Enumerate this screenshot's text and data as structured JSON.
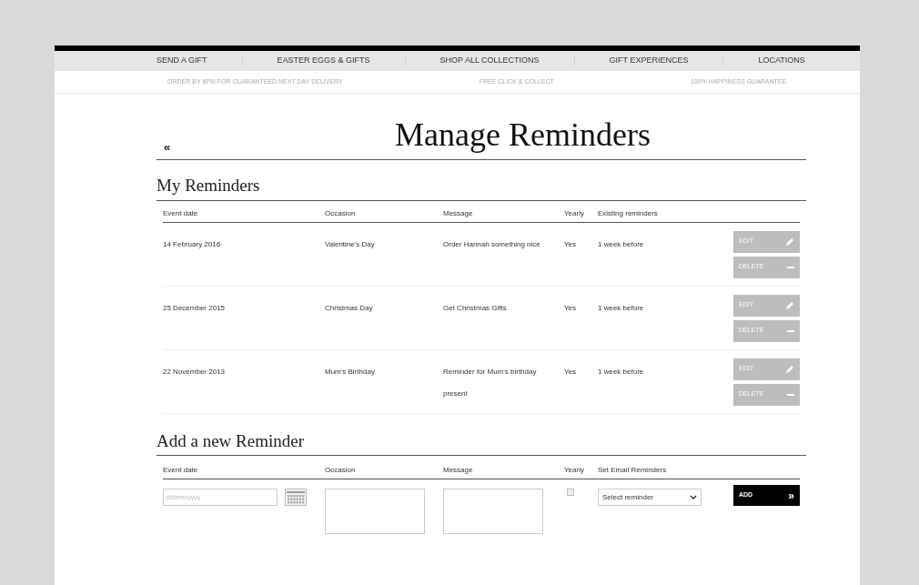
{
  "nav": {
    "items": [
      "SEND A GIFT",
      "EASTER EGGS & GIFTS",
      "SHOP ALL COLLECTIONS",
      "GIFT EXPERIENCES",
      "LOCATIONS"
    ],
    "promos": [
      "ORDER BY 6PM FOR GUARANTEED NEXT DAY DELIVERY",
      "FREE CLICK & COLLECT",
      "100% HAPPINESS GUARANTEE"
    ]
  },
  "page": {
    "back": "«",
    "title": "Manage Reminders"
  },
  "my_reminders": {
    "heading": "My Reminders",
    "columns": [
      "Event date",
      "Occasion",
      "Message",
      "Yearly",
      "Existing reminders"
    ],
    "rows": [
      {
        "date": "14 February 2016",
        "occasion": "Valentine's Day",
        "message": "Order Hannah something nice",
        "yearly": "Yes",
        "existing": "1 week before",
        "edit": "EDIT",
        "delete": "DELETE"
      },
      {
        "date": "25 December 2015",
        "occasion": "Christmas Day",
        "message": "Get Christmas Gifts",
        "yearly": "Yes",
        "existing": "1 week before",
        "edit": "EDIT",
        "delete": "DELETE"
      },
      {
        "date": "22 November 2013",
        "occasion": "Mum's Birthday",
        "message": "Reminder for Mum's birthday present",
        "yearly": "Yes",
        "existing": "1 week before",
        "edit": "EDIT",
        "delete": "DELETE"
      }
    ]
  },
  "add_reminder": {
    "heading": "Add a new Reminder",
    "columns": [
      "Event date",
      "Occasion",
      "Message",
      "Yearly",
      "Set Email Reminders"
    ],
    "date_placeholder": "dd/mm/yyyy",
    "yearly_checked": false,
    "reminder_select": "Select reminder",
    "add_button": "ADD",
    "add_arrow": "»"
  }
}
